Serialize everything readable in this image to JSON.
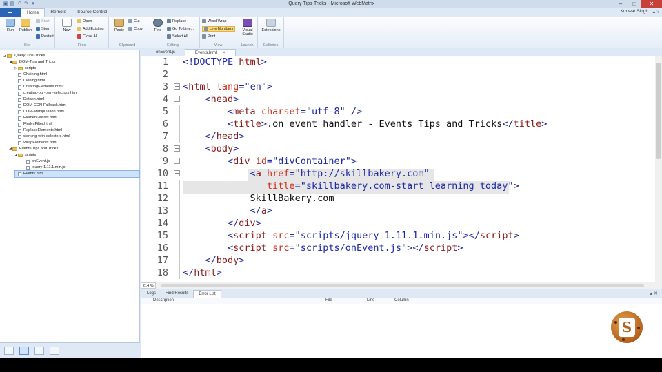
{
  "window": {
    "title": "jQuery-Tips-Tricks - Microsoft WebMatrix",
    "user": "Kunwar Singh"
  },
  "ribbon_tabs": [
    "Home",
    "Remote",
    "Source Control"
  ],
  "ribbon": {
    "site": {
      "run": "Run",
      "publish": "Publish",
      "start": "Start",
      "stop": "Stop",
      "restart": "Restart",
      "label": "Site"
    },
    "files": {
      "new": "New",
      "open": "Open",
      "add_existing": "Add Existing",
      "close_all": "Close All",
      "label": "Files"
    },
    "clipboard": {
      "paste": "Paste",
      "cut": "Cut",
      "copy": "Copy",
      "label": "Clipboard"
    },
    "editing": {
      "find": "Find",
      "replace": "Replace",
      "go_to_line": "Go To Line...",
      "select_all": "Select All",
      "label": "Editing"
    },
    "view": {
      "word_wrap": "Word Wrap",
      "line_numbers": "Line Numbers",
      "print": "Print",
      "label": "View"
    },
    "launch": {
      "visual_studio": "Visual Studio",
      "label": "Launch"
    },
    "galleries": {
      "extensions": "Extensions",
      "label": "Galleries"
    }
  },
  "tree": [
    "jQuery-Tips-Tricks",
    "DOM-Tips and Tricks",
    "scripts",
    "Chaining.html",
    "Cloning.html",
    "CreatingElements.html",
    "creating-our-own-selectors.html",
    "Detach.html",
    "DOM-CDN-Fallback.html",
    "DOM-Manipulation.html",
    "Element-exists.html",
    "FindvsFilter.html",
    "ReplaceElements.html",
    "working-with-selectors.html",
    "WrapElements.html",
    "Events-Tips and Tricks",
    "scripts",
    "onEvent.js",
    "jquery-1.11.1.min.js",
    "Events.html"
  ],
  "doc_tabs": [
    "onEvent.js",
    "Events.html"
  ],
  "code": {
    "line_numbers": [
      "1",
      "2",
      "3",
      "4",
      "5",
      "6",
      "7",
      "8",
      "9",
      "10",
      "11",
      "12",
      "13",
      "14",
      "15",
      "16",
      "17",
      "18"
    ],
    "l1_a": "<!DOCTYPE ",
    "l1_b": "html",
    "l1_c": ">",
    "l3_tag": "html",
    "l3_attr": "lang",
    "l3_val": "\"en\"",
    "l4_tag": "head",
    "l5_tag": "meta",
    "l5_attr": "charset",
    "l5_val": "\"utf-8\"",
    "l5_end": " />",
    "l6_tag": "title",
    "l6_text": ".on event handler - Events Tips and Tricks",
    "l6_close": "title",
    "l7_tag": "head",
    "l8_tag": "body",
    "l9_tag": "div",
    "l9_attr": "id",
    "l9_val": "\"divContainer\"",
    "l10_tag": "a",
    "l10_attr": "href",
    "l10_val": "\"http://skillbakery.com\"",
    "l11_attr": "title",
    "l11_val": "\"skillbakery.com-start learning today\"",
    "l12_text": "SkillBakery.com",
    "l13_tag": "a",
    "l14_tag": "div",
    "l15_tag": "script",
    "l15_attr": "src",
    "l15_val": "\"scripts/jquery-1.11.1.min.js\"",
    "l15_close": "script",
    "l16_tag": "script",
    "l16_attr": "src",
    "l16_val": "\"scripts/onEvent.js\"",
    "l16_close": "script",
    "l17_tag": "body",
    "l18_tag": "html"
  },
  "zoom": "214 %",
  "bottom_tabs": [
    "Logs",
    "Find Results",
    "Error List"
  ],
  "error_columns": [
    "Description",
    "File",
    "Line",
    "Column"
  ],
  "logo_letter": "S"
}
